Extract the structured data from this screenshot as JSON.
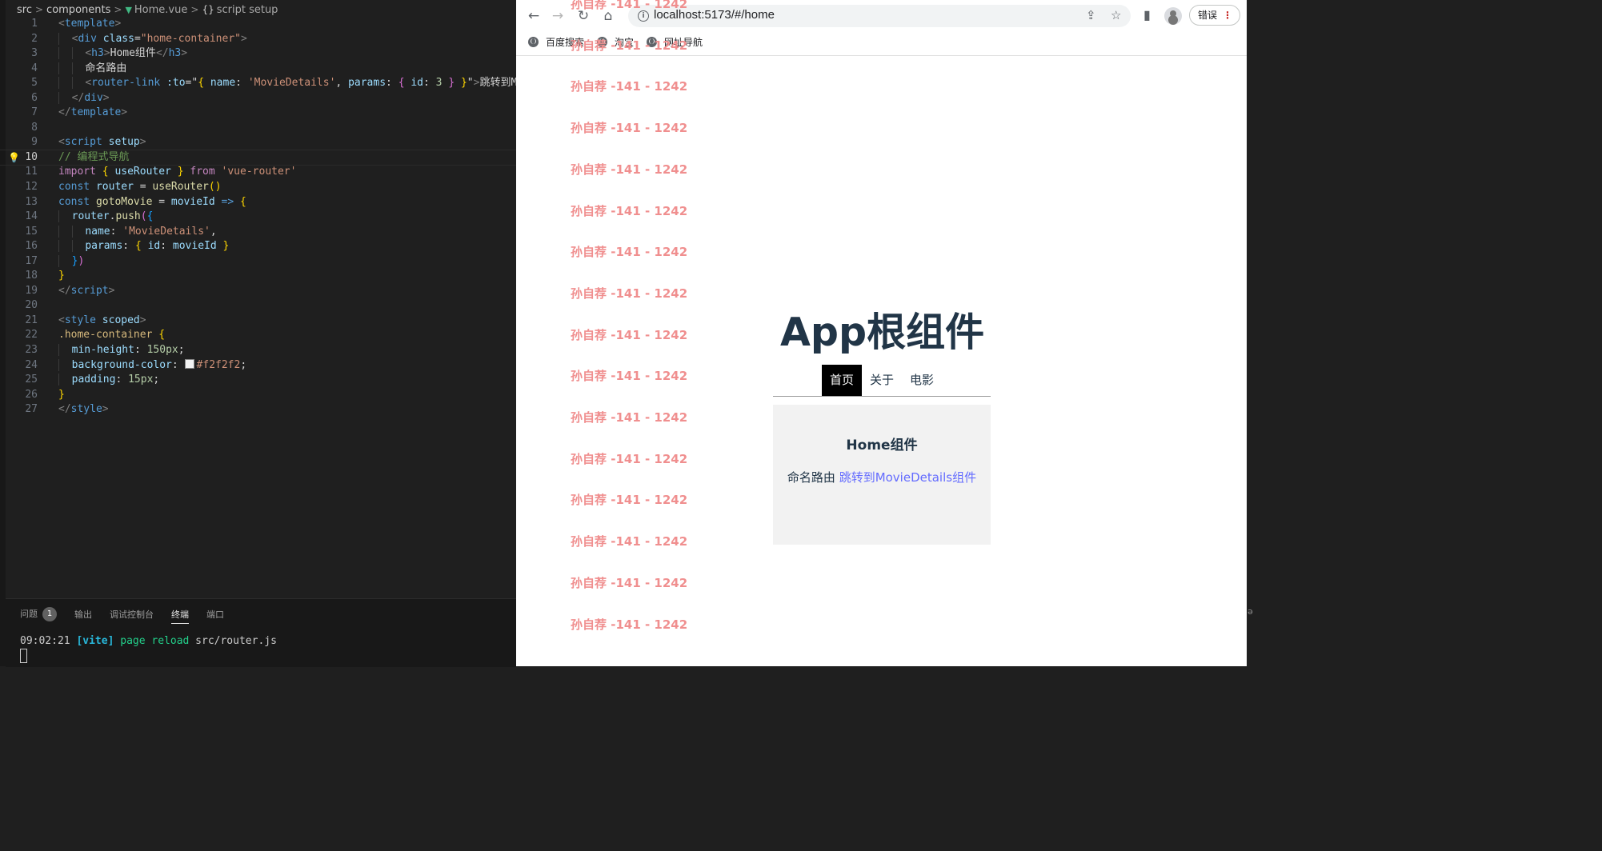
{
  "editor": {
    "breadcrumb": [
      "src",
      "components",
      "Home.vue",
      "script setup"
    ],
    "code": [
      {
        "n": "1",
        "h": "<span class=\"tg\">&lt;</span><span class=\"tn\">template</span><span class=\"tg\">&gt;</span>"
      },
      {
        "n": "2",
        "h": "<span class=\"ind\">  </span><span class=\"tg\">&lt;</span><span class=\"tn\">div</span> <span class=\"at\">class</span><span class=\"pl\">=</span><span class=\"sv\">\"home-container\"</span><span class=\"tg\">&gt;</span>"
      },
      {
        "n": "3",
        "h": "<span class=\"ind\">  </span><span class=\"ind\">  </span><span class=\"tg\">&lt;</span><span class=\"tn\">h3</span><span class=\"tg\">&gt;</span><span class=\"pl\">Home组件</span><span class=\"tg\">&lt;/</span><span class=\"tn\">h3</span><span class=\"tg\">&gt;</span>"
      },
      {
        "n": "4",
        "h": "<span class=\"ind\">  </span><span class=\"ind\">  </span><span class=\"pl\">命名路由</span>"
      },
      {
        "n": "5",
        "h": "<span class=\"ind\">  </span><span class=\"ind\">  </span><span class=\"tg\">&lt;</span><span class=\"tn\">router-link</span> <span class=\"at\">:to</span><span class=\"pl\">=\"</span><span class=\"b1\">{</span> <span class=\"vr\">name</span><span class=\"pl\">: </span><span class=\"sv\">'MovieDetails'</span><span class=\"pl\">, </span><span class=\"vr\">params</span><span class=\"pl\">: </span><span class=\"b2\">{</span> <span class=\"vr\">id</span><span class=\"pl\">: </span><span class=\"nm\">3</span> <span class=\"b2\">}</span> <span class=\"b1\">}</span><span class=\"pl\">\"</span><span class=\"tg\">&gt;</span><span class=\"pl\">跳转到MovieDetails组件</span>"
      },
      {
        "n": "6",
        "h": "<span class=\"ind\">  </span><span class=\"tg\">&lt;/</span><span class=\"tn\">div</span><span class=\"tg\">&gt;</span>"
      },
      {
        "n": "7",
        "h": "<span class=\"tg\">&lt;/</span><span class=\"tn\">template</span><span class=\"tg\">&gt;</span>"
      },
      {
        "n": "8",
        "h": ""
      },
      {
        "n": "9",
        "h": "<span class=\"tg\">&lt;</span><span class=\"tn\">script</span> <span class=\"at\">setup</span><span class=\"tg\">&gt;</span>"
      },
      {
        "n": "10",
        "h": "<span class=\"cm\">// 编程式导航</span>"
      },
      {
        "n": "11",
        "h": "<span class=\"kw\">import</span> <span class=\"b1\">{</span> <span class=\"vr\">useRouter</span> <span class=\"b1\">}</span> <span class=\"kw\">from</span> <span class=\"sv\">'vue-router'</span>"
      },
      {
        "n": "12",
        "h": "<span class=\"kb\">const</span> <span class=\"vr\">router</span> <span class=\"pl\">= </span><span class=\"fn\">useRouter</span><span class=\"b1\">()</span>"
      },
      {
        "n": "13",
        "h": "<span class=\"kb\">const</span> <span class=\"fn\">gotoMovie</span> <span class=\"pl\">= </span><span class=\"vr\">movieId</span> <span class=\"kb\">=&gt;</span> <span class=\"b1\">{</span>"
      },
      {
        "n": "14",
        "h": "<span class=\"ind\">  </span><span class=\"vr\">router</span><span class=\"pl\">.</span><span class=\"fn\">push</span><span class=\"b2\">(</span><span class=\"b3\">{</span>"
      },
      {
        "n": "15",
        "h": "<span class=\"ind\">  </span><span class=\"ind\">  </span><span class=\"vr\">name</span><span class=\"pl\">: </span><span class=\"sv\">'MovieDetails'</span><span class=\"pl\">,</span>"
      },
      {
        "n": "16",
        "h": "<span class=\"ind\">  </span><span class=\"ind\">  </span><span class=\"vr\">params</span><span class=\"pl\">: </span><span class=\"b1\">{</span> <span class=\"vr\">id</span><span class=\"pl\">: </span><span class=\"vr\">movieId</span> <span class=\"b1\">}</span>"
      },
      {
        "n": "17",
        "h": "<span class=\"ind\">  </span><span class=\"b3\">}</span><span class=\"b2\">)</span>"
      },
      {
        "n": "18",
        "h": "<span class=\"b1\">}</span>"
      },
      {
        "n": "19",
        "h": "<span class=\"tg\">&lt;/</span><span class=\"tn\">script</span><span class=\"tg\">&gt;</span>"
      },
      {
        "n": "20",
        "h": ""
      },
      {
        "n": "21",
        "h": "<span class=\"tg\">&lt;</span><span class=\"tn\">style</span> <span class=\"at\">scoped</span><span class=\"tg\">&gt;</span>"
      },
      {
        "n": "22",
        "h": "<span class=\"cs\">.home-container</span> <span class=\"b1\">{</span>"
      },
      {
        "n": "23",
        "h": "<span class=\"ind\">  </span><span class=\"cp\">min-height</span><span class=\"pl\">: </span><span class=\"nm\">150px</span><span class=\"pl\">;</span>"
      },
      {
        "n": "24",
        "h": "<span class=\"ind\">  </span><span class=\"cp\">background-color</span><span class=\"pl\">: </span><span class=\"swatch\"></span><span class=\"sv\">#f2f2f2</span><span class=\"pl\">;</span>"
      },
      {
        "n": "25",
        "h": "<span class=\"ind\">  </span><span class=\"cp\">padding</span><span class=\"pl\">: </span><span class=\"nm\">15px</span><span class=\"pl\">;</span>"
      },
      {
        "n": "26",
        "h": "<span class=\"b1\">}</span>"
      },
      {
        "n": "27",
        "h": "<span class=\"tg\">&lt;/</span><span class=\"tn\">style</span><span class=\"tg\">&gt;</span>"
      }
    ],
    "current_line": "10"
  },
  "panel": {
    "tabs": [
      "问题",
      "输出",
      "调试控制台",
      "终端",
      "端口"
    ],
    "problems_count": "1",
    "active_tab": "终端",
    "terminal": {
      "time": "09:02:21",
      "tag": "[vite]",
      "msg": "page reload",
      "path": "src/router.js"
    }
  },
  "browser": {
    "url": "localhost:5173/#/home",
    "error_label": "错误",
    "bookmarks": [
      "百度搜索",
      "淘宝",
      "网址导航"
    ],
    "watermark": "孙自荐 -141 - 1242",
    "app_title": "App根组件",
    "nav": [
      "首页",
      "关于",
      "电影"
    ],
    "nav_active": "首页",
    "home_title": "Home组件",
    "home_text": "命名路由",
    "home_link": "跳转到MovieDetails组件"
  },
  "icons": {
    "back": "arrow-left-icon",
    "forward": "arrow-right-icon",
    "reload": "reload-icon",
    "home": "home-icon",
    "share": "share-icon",
    "star": "star-icon",
    "sidepanel": "side-panel-icon",
    "profile": "avatar-icon",
    "menu": "kebab-menu-icon"
  },
  "colors": {
    "accent_link": "#646cff",
    "watermark": "#f08f8f",
    "nav_active_bg": "#000000",
    "container_bg": "#f2f2f2"
  }
}
